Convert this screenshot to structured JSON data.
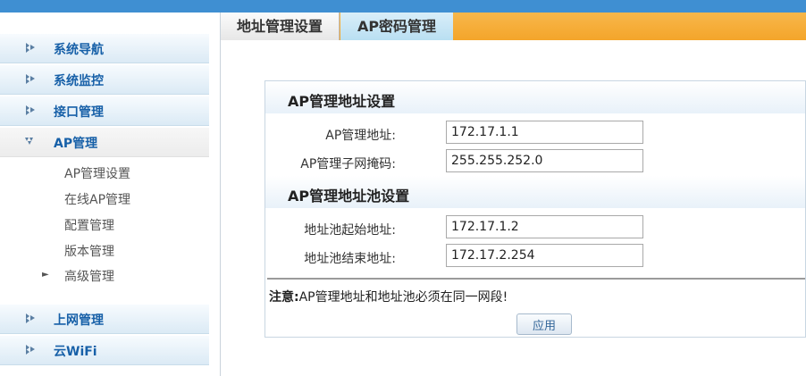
{
  "sidebar": {
    "items": [
      {
        "label": "系统导航"
      },
      {
        "label": "系统监控"
      },
      {
        "label": "接口管理"
      },
      {
        "label": "AP管理"
      },
      {
        "label": "上网管理"
      },
      {
        "label": "云WiFi"
      }
    ],
    "ap_subitems": [
      {
        "label": "AP管理设置"
      },
      {
        "label": "在线AP管理"
      },
      {
        "label": "配置管理"
      },
      {
        "label": "版本管理"
      },
      {
        "label": "高级管理"
      }
    ]
  },
  "tabs": [
    {
      "label": "地址管理设置",
      "active": true
    },
    {
      "label": "AP密码管理",
      "active": false
    }
  ],
  "form": {
    "section1_title": "AP管理地址设置",
    "ap_address_label": "AP管理地址:",
    "ap_address_value": "172.17.1.1",
    "ap_subnet_label": "AP管理子网掩码:",
    "ap_subnet_value": "255.255.252.0",
    "section2_title": "AP管理地址池设置",
    "pool_start_label": "地址池起始地址:",
    "pool_start_value": "172.17.1.2",
    "pool_end_label": "地址池结束地址:",
    "pool_end_value": "172.17.2.254",
    "note_prefix": "注意:",
    "note_text": "AP管理地址和地址池必须在同一网段!",
    "apply_label": "应用"
  },
  "colors": {
    "topbar": "#3f8fd2",
    "tabbar_accent": "#f4a52a",
    "nav_text": "#1760a8"
  }
}
